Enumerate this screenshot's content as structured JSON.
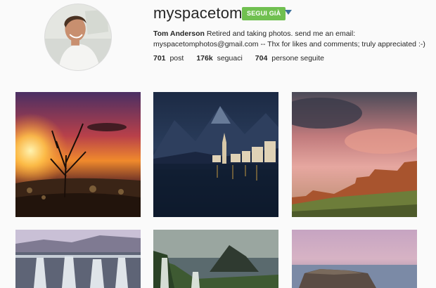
{
  "profile": {
    "username": "myspacetom",
    "follow_label": "SEGUI GIÀ",
    "full_name": "Tom Anderson",
    "bio": "Retired and taking photos. send me an email: myspacetomphotos@gmail.com -- Thx for likes and comments; truly appreciated :-)"
  },
  "stats": {
    "posts": {
      "value": "701",
      "label": "post"
    },
    "followers": {
      "value": "176k",
      "label": "seguaci"
    },
    "following": {
      "value": "704",
      "label": "persone seguite"
    }
  },
  "icons": {
    "dropdown": "caret-down-icon"
  },
  "colors": {
    "follow_button": "#70c050",
    "dropdown_caret": "#3f729b"
  }
}
